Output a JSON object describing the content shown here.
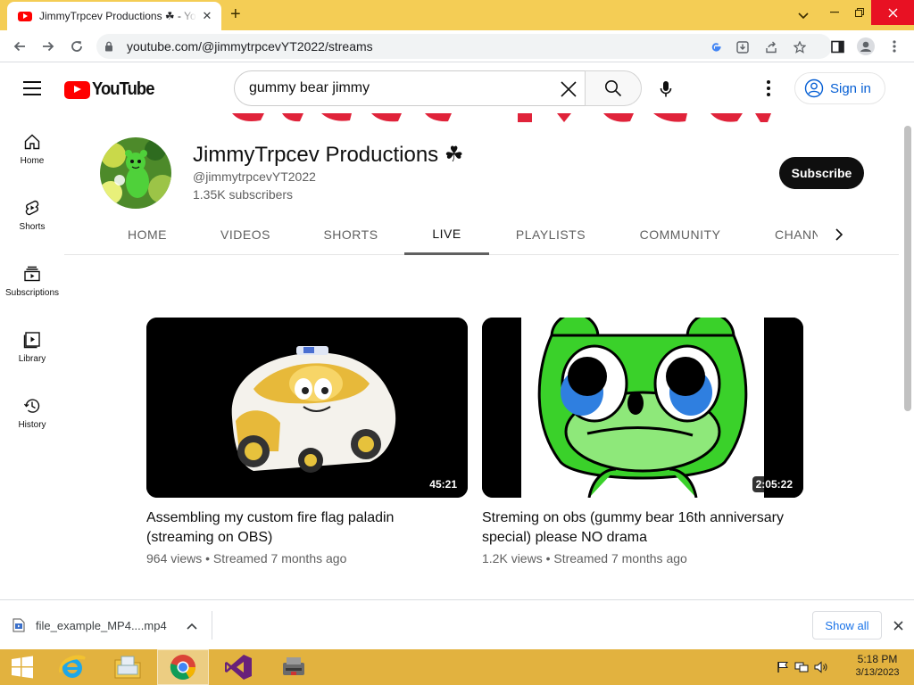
{
  "browser": {
    "tab_title": "JimmyTrpcev Productions ☘ - YouTube",
    "url": "youtube.com/@jimmytrpcevYT2022/streams",
    "new_tab_label": "+",
    "close_tab_glyph": "✕"
  },
  "youtube": {
    "logo_text": "YouTube",
    "search_query": "gummy bear jimmy",
    "sign_in_label": "Sign in"
  },
  "guide": {
    "items": [
      {
        "label": "Home",
        "icon": "home-icon"
      },
      {
        "label": "Shorts",
        "icon": "shorts-icon"
      },
      {
        "label": "Subscriptions",
        "icon": "subscriptions-icon"
      },
      {
        "label": "Library",
        "icon": "library-icon"
      },
      {
        "label": "History",
        "icon": "history-icon"
      }
    ]
  },
  "channel": {
    "name": "JimmyTrpcev Productions ☘",
    "handle": "@jimmytrpcevYT2022",
    "subscribers": "1.35K subscribers",
    "subscribe_label": "Subscribe"
  },
  "channel_tabs": [
    {
      "label": "HOME",
      "active": false
    },
    {
      "label": "VIDEOS",
      "active": false
    },
    {
      "label": "SHORTS",
      "active": false
    },
    {
      "label": "LIVE",
      "active": true
    },
    {
      "label": "PLAYLISTS",
      "active": false
    },
    {
      "label": "COMMUNITY",
      "active": false
    },
    {
      "label": "CHANN",
      "active": false
    }
  ],
  "videos": [
    {
      "title": "Assembling my custom fire flag paladin (streaming on OBS)",
      "duration": "45:21",
      "meta": "964 views • Streamed 7 months ago"
    },
    {
      "title": "Streming on obs (gummy bear 16th anniversary special) please NO drama",
      "duration": "2:05:22",
      "meta": "1.2K views • Streamed 7 months ago"
    }
  ],
  "downloads": {
    "file_name": "file_example_MP4....mp4",
    "show_all_label": "Show all"
  },
  "taskbar": {
    "time": "5:18 PM",
    "date": "3/13/2023"
  },
  "colors": {
    "tab_strip": "#f4cd55",
    "taskbar": "#e2b23f",
    "youtube_red": "#ff0000",
    "link_blue": "#065fd4"
  }
}
